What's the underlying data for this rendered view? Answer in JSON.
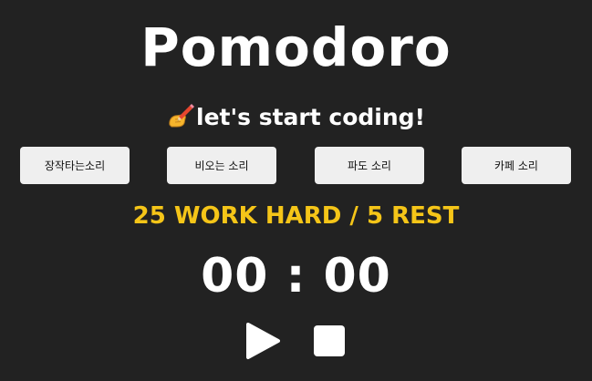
{
  "app": {
    "title": "Pomodoro",
    "subtitle": "let's start coding!",
    "subtitle_icon": "writing-hand-icon"
  },
  "sounds": [
    {
      "label": "장작타는소리"
    },
    {
      "label": "비오는 소리"
    },
    {
      "label": "파도 소리"
    },
    {
      "label": "카페 소리"
    }
  ],
  "mode": {
    "label": "25 WORK HARD / 5 REST"
  },
  "timer": {
    "display": "00 : 00"
  },
  "controls": {
    "play_icon": "play-icon",
    "stop_icon": "stop-icon"
  },
  "colors": {
    "background": "#222222",
    "text": "#ffffff",
    "accent": "#f5c518",
    "button_bg": "#efefef"
  }
}
